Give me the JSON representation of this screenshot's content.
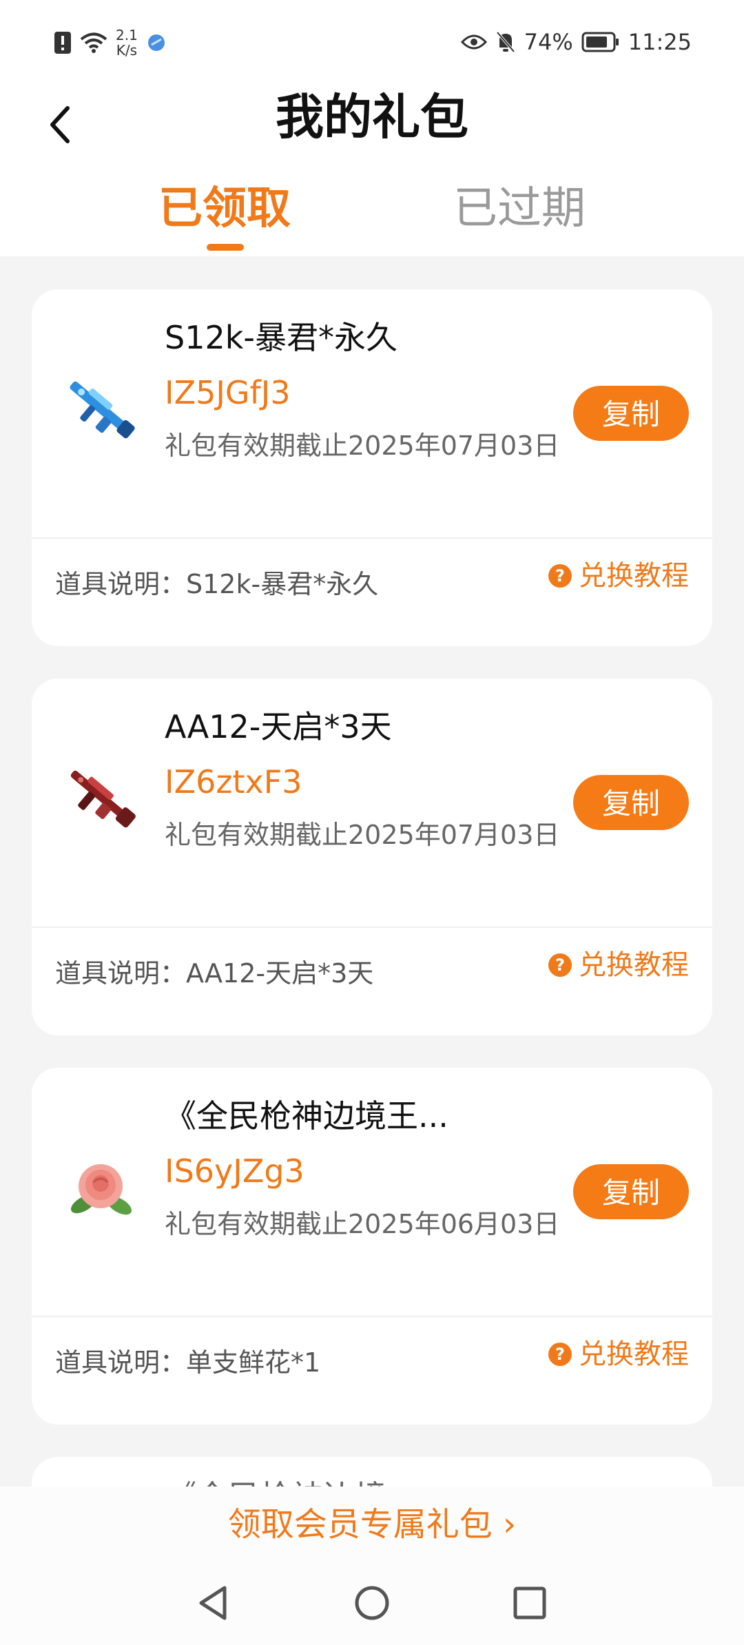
{
  "status": {
    "speed_top": "2.1",
    "speed_bottom": "K/s",
    "battery": "74%",
    "time": "11:25"
  },
  "header": {
    "title": "我的礼包",
    "tabs": [
      {
        "label": "已领取"
      },
      {
        "label": "已过期"
      }
    ]
  },
  "cards": [
    {
      "name": "S12k-暴君*永久",
      "code": "IZ5JGfJ3",
      "expire": "礼包有效期截止2025年07月03日",
      "copy_label": "复制",
      "desc": "道具说明：S12k-暴君*永久",
      "tutorial_label": "兑换教程",
      "icon": "rifle-blue-icon"
    },
    {
      "name": "AA12-天启*3天",
      "code": "IZ6ztxF3",
      "expire": "礼包有效期截止2025年07月03日",
      "copy_label": "复制",
      "desc": "道具说明：AA12-天启*3天",
      "tutorial_label": "兑换教程",
      "icon": "rifle-red-icon"
    },
    {
      "name": "《全民枪神边境王...",
      "code": "IS6yJZg3",
      "expire": "礼包有效期截止2025年06月03日",
      "copy_label": "复制",
      "desc": "道具说明：单支鲜花*1",
      "tutorial_label": "兑换教程",
      "icon": "rose-icon"
    }
  ],
  "partial_card": {
    "name": "《全民枪神边境..."
  },
  "bottom": {
    "member_link": "领取会员专属礼包 ›"
  },
  "colors": {
    "accent": "#f07a1a",
    "button": "#f47b16"
  }
}
